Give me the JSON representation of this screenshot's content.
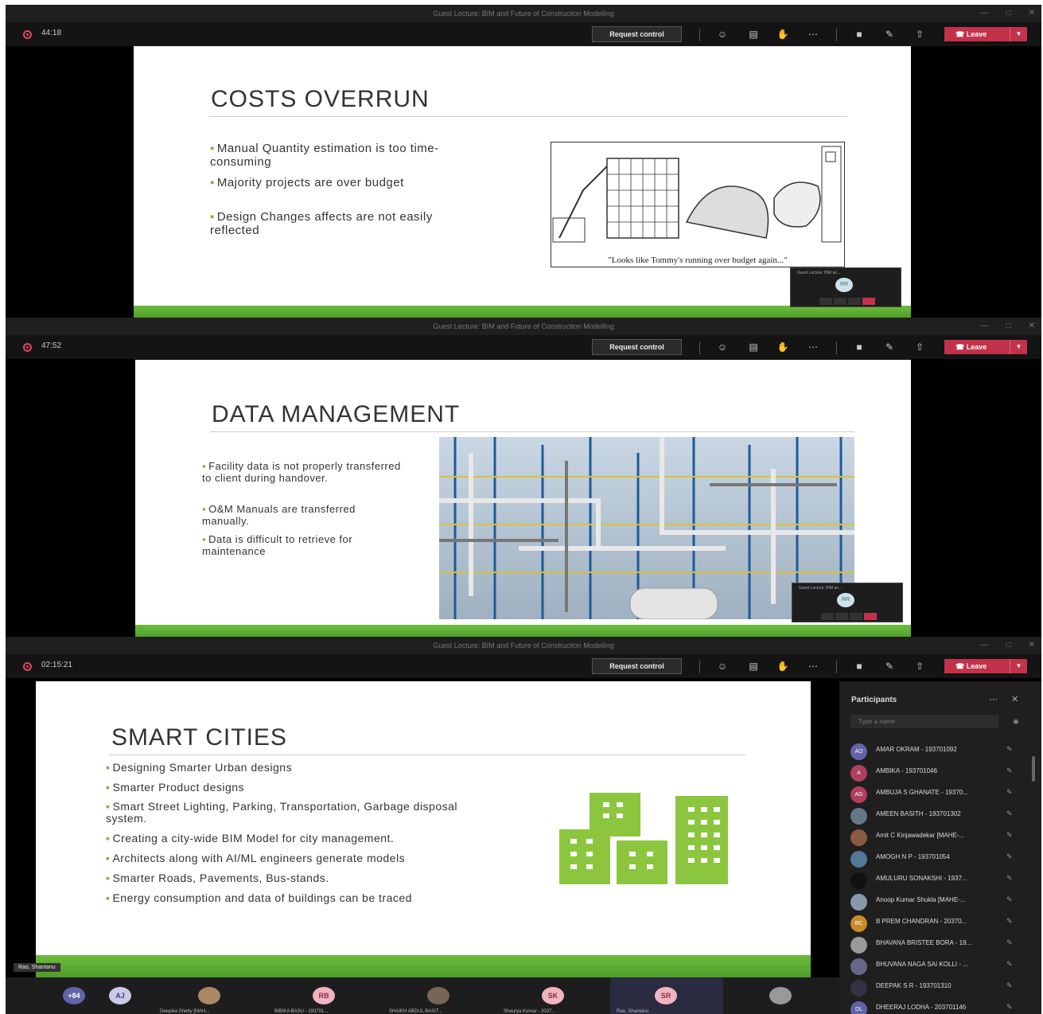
{
  "window_title": "Guest Lecture: BIM and Future of Construction Modelling",
  "window_controls": {
    "minimize": "—",
    "maximize": "□",
    "close": "✕"
  },
  "toolbar": {
    "request_control": "Request control",
    "leave": "Leave"
  },
  "screens": [
    {
      "timer": "44:18",
      "slide": {
        "title": "COSTS OVERRUN",
        "bullets": [
          "Manual Quantity estimation is too time-consuming",
          "Majority projects are over budget",
          "Design Changes affects are not easily reflected"
        ],
        "cartoon_caption": "\"Looks like Tommy's running over budget again...\""
      },
      "mini_window": {
        "title": "Guest Lecture: BIM an...",
        "avatar": "RR"
      }
    },
    {
      "timer": "47:52",
      "slide": {
        "title": "DATA MANAGEMENT",
        "bullets": [
          "Facility data is not properly transferred to client during handover.",
          "O&M Manuals are transferred manually.",
          "Data is difficult to retrieve for maintenance"
        ]
      },
      "mini_window": {
        "title": "Guest Lecture: BIM an...",
        "avatar": "RR"
      }
    },
    {
      "timer": "02:15:21",
      "slide": {
        "title": "SMART CITIES",
        "bullets": [
          "Designing Smarter Urban designs",
          "Smarter Product designs",
          "Smart Street Lighting, Parking, Transportation, Garbage disposal system.",
          "Creating a city-wide BIM Model for city management.",
          "Architects along with AI/ML engineers generate models",
          "Smarter Roads, Pavements, Bus-stands.",
          "Energy consumption and data of buildings can be traced"
        ]
      },
      "presenter_tag": "Rao, Shantanu"
    }
  ],
  "participants": {
    "title": "Participants",
    "search_placeholder": "Type a name",
    "list": [
      {
        "initials": "AO",
        "name": "AMAR OKRAM - 193701092",
        "color": "#6264a7"
      },
      {
        "initials": "A",
        "name": "AMBIKA - 193701046",
        "color": "#b0405a"
      },
      {
        "initials": "AG",
        "name": "AMBUJA S GHANATE - 19370...",
        "color": "#b0405a"
      },
      {
        "initials": "",
        "name": "AMEEN BASITH - 193701302",
        "color": "#667788"
      },
      {
        "initials": "",
        "name": "Amit C Kinjawadekar [MAHE-...",
        "color": "#8a5a40"
      },
      {
        "initials": "",
        "name": "AMOGH N P - 193701054",
        "color": "#557799"
      },
      {
        "initials": "",
        "name": "AMULURU SONAKSHI - 1937...",
        "color": "#111111"
      },
      {
        "initials": "",
        "name": "Anoop Kumar Shukla [MAHE-...",
        "color": "#8899aa"
      },
      {
        "initials": "BC",
        "name": "B PREM CHANDRAN - 20370...",
        "color": "#c98a2a"
      },
      {
        "initials": "",
        "name": "BHAVANA BRISTEE BORA - 19...",
        "color": "#999999"
      },
      {
        "initials": "",
        "name": "BHUVANA NAGA SAI KOLLI - ...",
        "color": "#666688"
      },
      {
        "initials": "",
        "name": "DEEPAK S R - 193701310",
        "color": "#333344"
      },
      {
        "initials": "DL",
        "name": "DHEERAJ LODHA - 203701146",
        "color": "#6264a7"
      }
    ]
  },
  "bottom_tiles": [
    {
      "initials": "+84",
      "name": "",
      "color": "#6264a7"
    },
    {
      "initials": "AJ",
      "name": "",
      "color": "#c9cbe8"
    },
    {
      "initials": "",
      "name": "Deepika Shetty [MAH...",
      "color": "#aa8866"
    },
    {
      "initials": "RB",
      "name": "BIBIKA BASU - 193701...",
      "color": "#f1b3bf"
    },
    {
      "initials": "",
      "name": "SHAIKH ABDUL BASIT...",
      "color": "#776655"
    },
    {
      "initials": "SK",
      "name": "Shaurya Kumar - 2037...",
      "color": "#f1b3bf"
    },
    {
      "initials": "SR",
      "name": "Rao, Shantanu",
      "color": "#f1b3bf"
    },
    {
      "initials": "",
      "name": "",
      "color": "#999999"
    }
  ],
  "colors": {
    "accent_green": "#6bbd3a",
    "leave_red": "#c4314b",
    "teams_purple": "#6264a7"
  }
}
